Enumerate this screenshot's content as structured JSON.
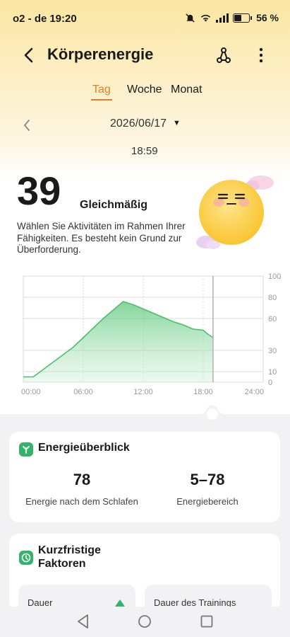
{
  "status": {
    "carrier": "o2 - de",
    "time": "19:20",
    "battery": "56 %"
  },
  "header": {
    "title": "Körperenergie"
  },
  "tabs": [
    {
      "label": "Tag"
    },
    {
      "label": "Woche"
    },
    {
      "label": "Monat"
    }
  ],
  "date": {
    "value": "2026/06/17",
    "time": "18:59"
  },
  "energy": {
    "value": "39",
    "status": "Gleichmäßig",
    "description": "Wählen Sie Aktivitäten im Rahmen Ihrer Fähigkeiten. Es besteht kein Grund zur Überforderung."
  },
  "chart_data": {
    "type": "area",
    "x": [
      "00:00",
      "01:00",
      "02:00",
      "03:00",
      "04:00",
      "05:00",
      "06:00",
      "07:00",
      "08:00",
      "09:00",
      "09:30",
      "10:00",
      "11:00",
      "12:00",
      "13:00",
      "14:00",
      "15:00",
      "16:00",
      "17:00",
      "18:00",
      "18:30",
      "18:59"
    ],
    "values": [
      5,
      5,
      12,
      19,
      26,
      33,
      42,
      51,
      60,
      68,
      72,
      76,
      73,
      69,
      65,
      61,
      57,
      54,
      50,
      49,
      45,
      42
    ],
    "x_ticks": [
      "00:00",
      "06:00",
      "12:00",
      "18:00",
      "24:00"
    ],
    "y_ticks": [
      "100",
      "80",
      "60",
      "30",
      "10",
      "0"
    ],
    "ylim": [
      0,
      100
    ],
    "color": "#4cbf6a"
  },
  "overview": {
    "title": "Energieüberblick",
    "after_sleep_value": "78",
    "after_sleep_label": "Energie nach dem Schlafen",
    "range_value": "5–78",
    "range_label": "Energiebereich"
  },
  "factors": {
    "title": "Kurzfristige Faktoren",
    "items": [
      {
        "label": "Dauer"
      },
      {
        "label": "Dauer des Trainings"
      }
    ]
  },
  "colors": {
    "accent": "#e67e22",
    "green": "#33b36b"
  }
}
